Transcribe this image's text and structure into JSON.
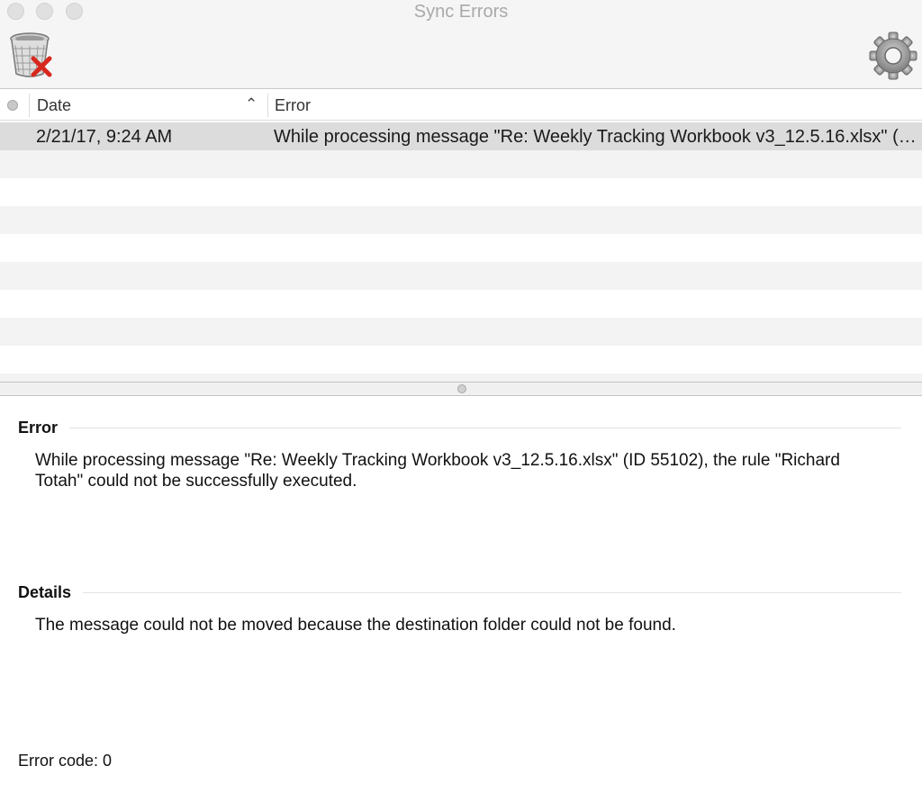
{
  "window": {
    "title": "Sync Errors"
  },
  "toolbar": {
    "clear_icon": "trash-delete-icon",
    "settings_icon": "gear-icon"
  },
  "table": {
    "columns": [
      "Date",
      "Error"
    ],
    "sort": "ascending",
    "rows": [
      {
        "date": "2/21/17, 9:24 AM",
        "error": "While processing message \"Re: Weekly Tracking Workbook v3_12.5.16.xlsx\" (ID 55102), the rule \"Richard Totah\" could not be successfully executed."
      }
    ],
    "selected_index": 0
  },
  "detail": {
    "error_heading": "Error",
    "error_text": "While processing message \"Re: Weekly Tracking Workbook v3_12.5.16.xlsx\" (ID 55102), the rule \"Richard Totah\" could not be successfully executed.",
    "details_heading": "Details",
    "details_text": "The message could not be moved because the destination folder could not be found.",
    "error_code": "Error code: 0"
  }
}
